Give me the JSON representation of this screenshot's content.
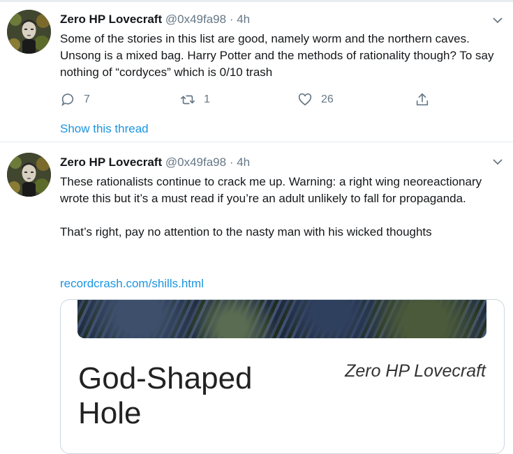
{
  "tweets": [
    {
      "name": "Zero HP Lovecraft",
      "handle": "@0x49fa98",
      "separator": "·",
      "time": "4h",
      "text": "Some of the stories in this list are good, namely worm and the northern caves. Unsong is a mixed bag. Harry Potter and the methods of rationality though? To say nothing of “cordyces” which is 0/10 trash",
      "replies": "7",
      "retweets": "1",
      "likes": "26",
      "show_thread": "Show this thread"
    },
    {
      "name": "Zero HP Lovecraft",
      "handle": "@0x49fa98",
      "separator": "·",
      "time": "4h",
      "text": "These rationalists continue to crack me up. Warning: a right wing neoreactionary wrote this but it’s a must read if you’re an adult unlikely to fall for propaganda.\n\nThat’s right, pay no attention to the nasty man with his wicked thoughts",
      "link": "recordcrash.com/shills.html",
      "card": {
        "title": "God-Shaped Hole",
        "author": "Zero HP Lovecraft"
      }
    }
  ],
  "icons": {
    "reply": "speech-bubble-icon",
    "retweet": "retweet-arrows-icon",
    "like": "heart-icon",
    "share": "share-upload-icon",
    "more": "chevron-down-icon"
  },
  "colors": {
    "link": "#1b95e0",
    "muted": "#657786",
    "text": "#14171a",
    "divider": "#e6ecf0"
  }
}
